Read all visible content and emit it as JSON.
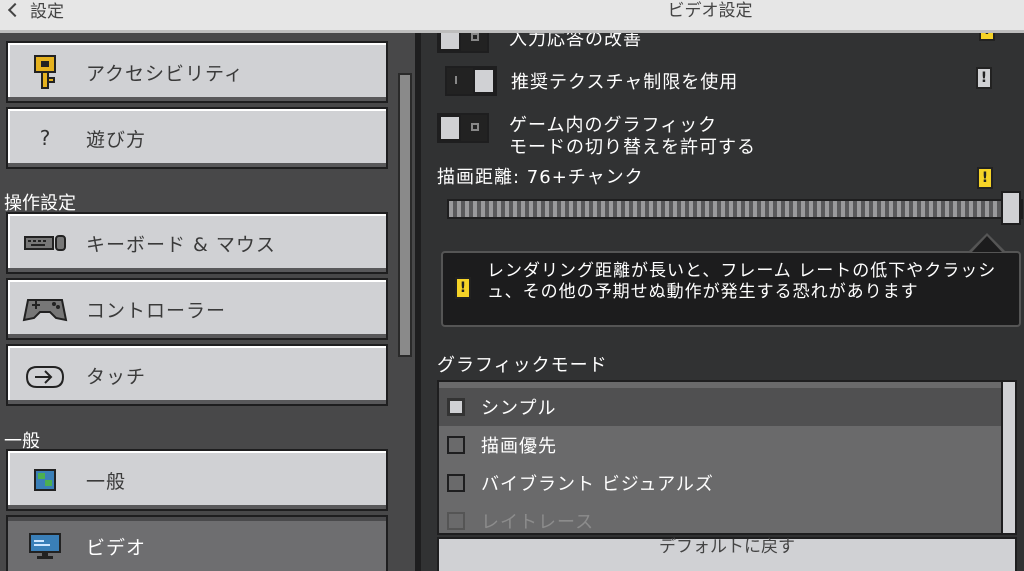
{
  "header": {
    "back_label": "設定",
    "title": "ビデオ設定"
  },
  "sidebar": {
    "items_top": [
      {
        "label": "アクセシビリティ",
        "icon": "key-icon"
      },
      {
        "label": "遊び方",
        "icon": "question-icon",
        "icon_text": "?"
      }
    ],
    "section_controls": "操作設定",
    "items_controls": [
      {
        "label": "キーボード & マウス",
        "icon": "keyboard-mouse-icon"
      },
      {
        "label": "コントローラー",
        "icon": "controller-icon"
      },
      {
        "label": "タッチ",
        "icon": "touch-icon"
      }
    ],
    "section_general": "一般",
    "items_general": [
      {
        "label": "一般",
        "icon": "globe-icon"
      },
      {
        "label": "ビデオ",
        "icon": "monitor-icon",
        "active": true
      }
    ]
  },
  "settings": {
    "input_response": "入力応答の改善",
    "recommended_texture": "推奨テクスチャ制限を使用",
    "graphics_mode_switch_line1": "ゲーム内のグラフィック",
    "graphics_mode_switch_line2": "モードの切り替えを許可する",
    "render_distance_label": "描画距離: 76+チャンク",
    "render_distance_value": 1.0,
    "warning_icon_text": "!",
    "tooltip": "レンダリング距離が長いと、フレーム レートの低下やクラッシュ、その他の予期せぬ動作が発生する恐れがあります",
    "graphics_mode_header": "グラフィックモード",
    "graphics_modes": [
      {
        "label": "シンプル",
        "checked": true
      },
      {
        "label": "描画優先",
        "checked": false
      },
      {
        "label": "バイブラント ビジュアルズ",
        "checked": false
      },
      {
        "label": "レイトレース",
        "checked": false,
        "disabled": true
      }
    ],
    "reset_label": "デフォルトに戻す"
  },
  "colors": {
    "warning": "#f5d327",
    "panel": "#484849",
    "button": "#d0d1d4"
  }
}
